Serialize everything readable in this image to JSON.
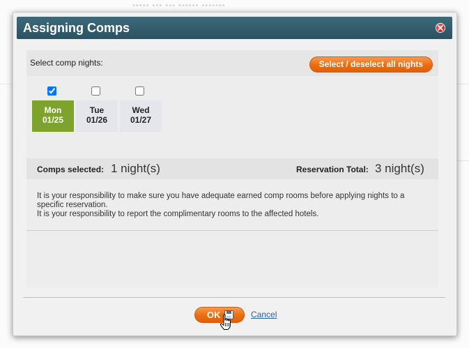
{
  "dialog": {
    "title": "Assigning Comps"
  },
  "nights_panel": {
    "label": "Select comp nights:",
    "select_all_label": "Select / deselect all nights",
    "nights": [
      {
        "day": "Mon",
        "date": "01/25",
        "checked": true
      },
      {
        "day": "Tue",
        "date": "01/26",
        "checked": false
      },
      {
        "day": "Wed",
        "date": "01/27",
        "checked": false
      }
    ]
  },
  "summary": {
    "comps_label": "Comps selected:",
    "comps_value": "1 night(s)",
    "total_label": "Reservation Total:",
    "total_value": "3 night(s)"
  },
  "notes": {
    "line1": "It is your responsibility to make sure you have adequate earned comp rooms before applying nights to a specific reservation.",
    "line2": "It is your responsibility to report the complimentary rooms to the affected hotels."
  },
  "footer": {
    "ok_label": "OK",
    "cancel_label": "Cancel"
  },
  "colors": {
    "titlebar": "#2f5a6a",
    "accent_orange": "#ea6c0e",
    "selected_green": "#7ea32c",
    "link_blue": "#2a5e9e"
  },
  "icons": [
    "close-icon",
    "save-icon",
    "hand-cursor-icon"
  ]
}
